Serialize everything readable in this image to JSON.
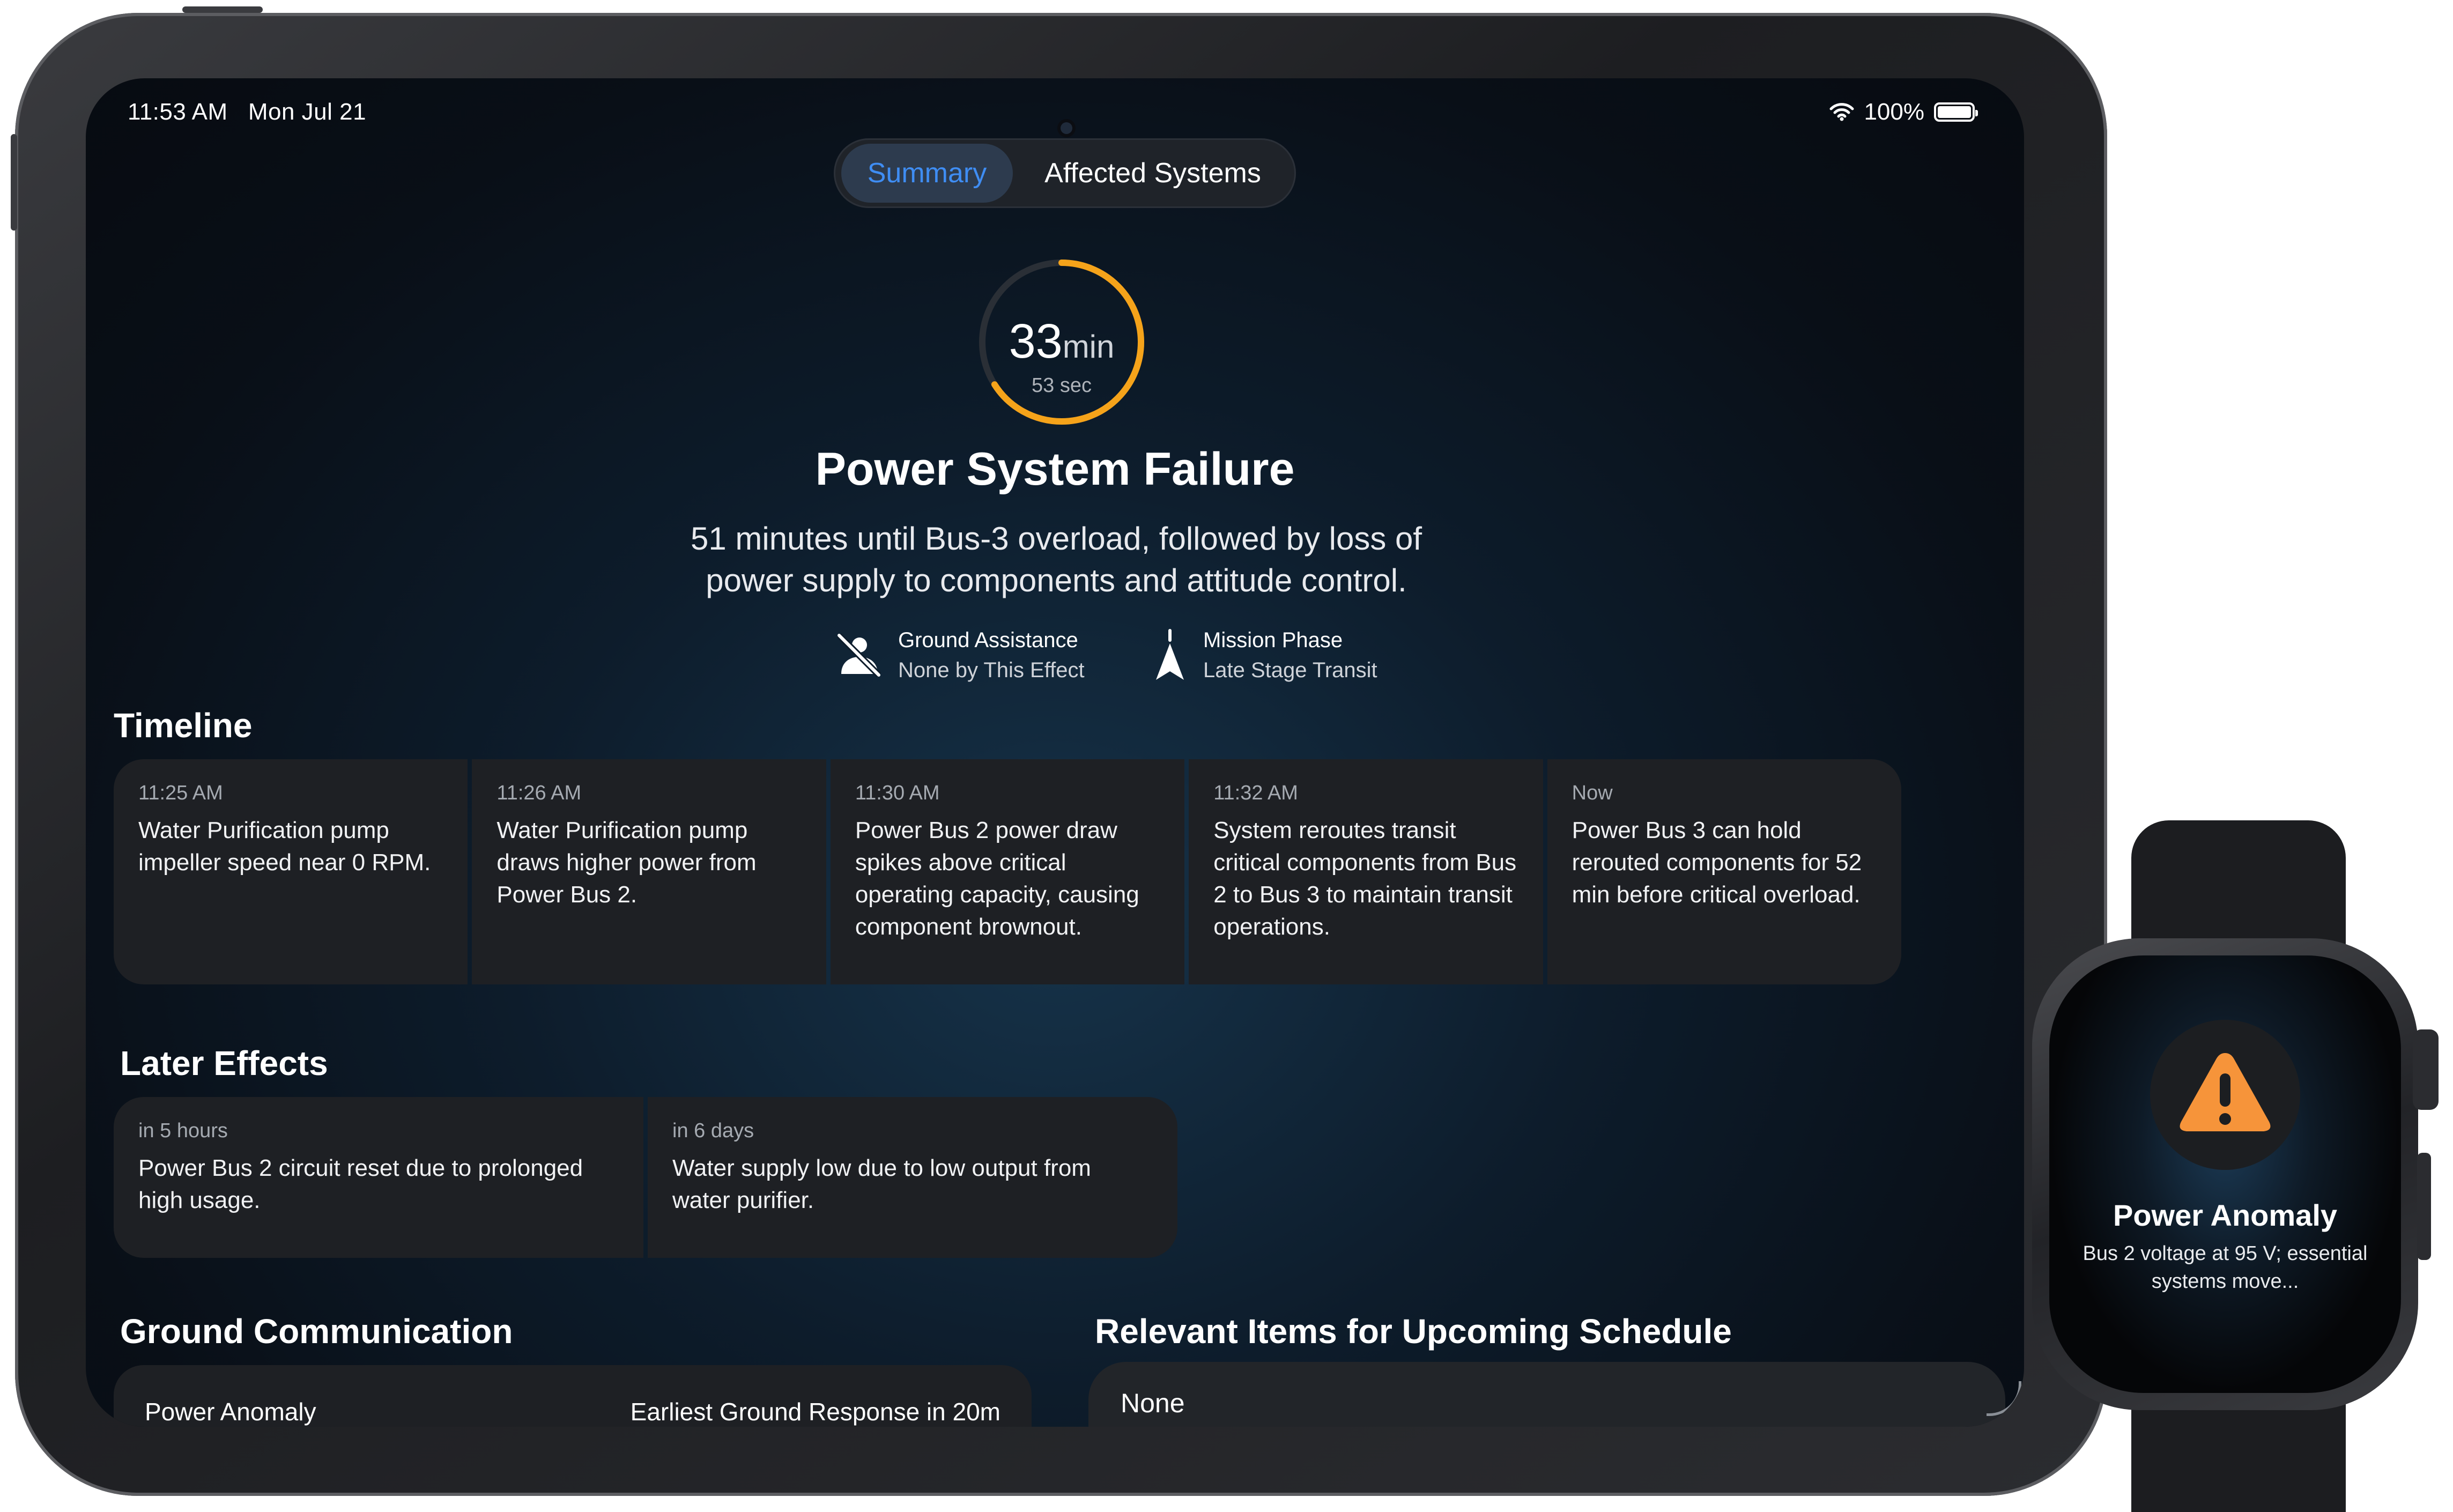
{
  "status_bar": {
    "time": "11:53 AM",
    "date": "Mon Jul 21",
    "battery": "100%"
  },
  "tabs": {
    "summary": "Summary",
    "affected": "Affected Systems"
  },
  "timer": {
    "value": "33",
    "unit": "min",
    "seconds": "53 sec",
    "progress": 0.66
  },
  "alert": {
    "title": "Power System Failure",
    "description": "51 minutes until Bus-3 overload, followed by loss of power supply to components and attitude control."
  },
  "meta": {
    "ground_label": "Ground Assistance",
    "ground_value": "None by This Effect",
    "phase_label": "Mission Phase",
    "phase_value": "Late Stage Transit"
  },
  "timeline": {
    "title": "Timeline",
    "items": [
      {
        "time": "11:25 AM",
        "text": "Water Purification pump impeller speed near 0 RPM."
      },
      {
        "time": "11:26 AM",
        "text": "Water Purification pump draws higher power from Power Bus 2."
      },
      {
        "time": "11:30 AM",
        "text": "Power Bus 2 power draw spikes above critical operating capacity, causing component brownout."
      },
      {
        "time": "11:32 AM",
        "text": "System reroutes transit critical components from Bus 2 to Bus 3 to maintain transit operations."
      },
      {
        "time": "Now",
        "text": "Power Bus 3 can hold rerouted components for 52 min before critical overload."
      }
    ]
  },
  "later_effects": {
    "title": "Later Effects",
    "items": [
      {
        "time": "in 5 hours",
        "text": "Power Bus 2 circuit reset due to prolonged high usage."
      },
      {
        "time": "in 6 days",
        "text": "Water supply low due to low output from water purifier."
      }
    ]
  },
  "ground_comm": {
    "title": "Ground Communication",
    "item": "Power Anomaly",
    "response": "Earliest Ground Response in 20m"
  },
  "schedule": {
    "title": "Relevant Items for Upcoming Schedule",
    "value": "None"
  },
  "watch": {
    "title": "Power Anomaly",
    "body": "Bus 2 voltage at 95 V; essential systems move..."
  },
  "colors": {
    "accent_orange": "#f5a31a",
    "tab_blue": "#3f8df3",
    "card": "#1e2024"
  }
}
